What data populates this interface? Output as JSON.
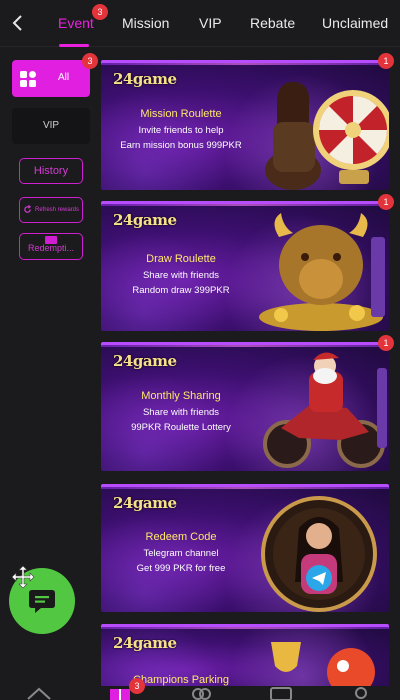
{
  "nav": {
    "tabs": [
      {
        "label": "Event",
        "active": true,
        "badge": "3"
      },
      {
        "label": "Mission"
      },
      {
        "label": "VIP"
      },
      {
        "label": "Rebate"
      },
      {
        "label": "Unclaimed"
      }
    ]
  },
  "sidebar": {
    "all": {
      "label": "All",
      "badge": "3"
    },
    "vip": {
      "label": "VIP"
    },
    "history": {
      "label": "History"
    },
    "refresh": {
      "label": "Refresh rewards"
    },
    "redemption": {
      "label": "Redempti..."
    }
  },
  "cards": [
    {
      "logo": "24game",
      "title": "Mission Roulette",
      "line1": "Invite friends to help",
      "line2": "Earn mission bonus 999PKR",
      "badge": "1"
    },
    {
      "logo": "24game",
      "title": "Draw Roulette",
      "line1": "Share with friends",
      "line2": "Random draw 399PKR",
      "badge": "1"
    },
    {
      "logo": "24game",
      "title": "Monthly Sharing",
      "line1": "Share with friends",
      "line2": "99PKR Roulette Lottery",
      "badge": "1"
    },
    {
      "logo": "24game",
      "title": "Redeem Code",
      "line1": "Telegram channel",
      "line2": "Get 999 PKR for free"
    },
    {
      "logo": "24game",
      "title": "Champions Parking"
    }
  ],
  "bottom": {
    "badge": "3"
  },
  "colors": {
    "accent": "#e01fe0",
    "badge": "#e2343a",
    "chat": "#52c742",
    "title": "#ffe86a"
  }
}
